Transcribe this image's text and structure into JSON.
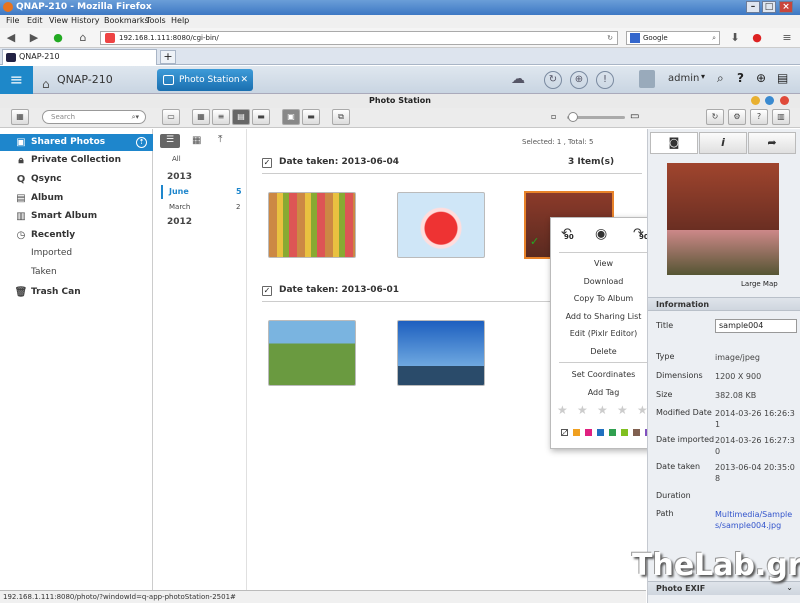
{
  "window": {
    "title": "QNAP-210 - Mozilla Firefox"
  },
  "menu": [
    "File",
    "Edit",
    "View",
    "History",
    "Bookmarks",
    "Tools",
    "Help"
  ],
  "nav": {
    "url": "192.168.1.111:8080/cgi-bin/",
    "search_placeholder": "Google"
  },
  "browser_tab": {
    "label": "QNAP-210",
    "new_tab": "+"
  },
  "header": {
    "home_label": "QNAP-210",
    "app_label": "Photo Station",
    "user": "admin"
  },
  "toolbar": {
    "title": "Photo Station",
    "search_placeholder": "Search"
  },
  "sidebar": {
    "items": [
      {
        "label": "Shared Photos",
        "icon": "photos-icon"
      },
      {
        "label": "Private Collection",
        "icon": "lock-icon"
      },
      {
        "label": "Qsync",
        "icon": "qsync-icon"
      },
      {
        "label": "Album",
        "icon": "album-icon"
      },
      {
        "label": "Smart Album",
        "icon": "smart-album-icon"
      },
      {
        "label": "Recently",
        "icon": "clock-icon"
      },
      {
        "label": "Trash Can",
        "icon": "trash-icon"
      }
    ],
    "sub": [
      "Imported",
      "Taken"
    ]
  },
  "timeline": {
    "all": "All",
    "y2013": "2013",
    "june": "June",
    "june_count": "5",
    "march": "March",
    "march_count": "2",
    "y2012": "2012"
  },
  "main": {
    "selection": "Selected: 1 , Total: 5",
    "group1": {
      "title": "Date taken: 2013-06-04",
      "count": "3 Item(s)"
    },
    "group2": {
      "title": "Date taken: 2013-06-01"
    }
  },
  "context_menu": {
    "rotate_left": "90",
    "rotate_right": "90",
    "items": [
      "View",
      "Download",
      "Copy To Album",
      "Add to Sharing List",
      "Edit (Pixlr Editor)",
      "Delete",
      "Set Coordinates",
      "Add Tag"
    ],
    "stars": 5,
    "colors": [
      "#f0a020",
      "#e02080",
      "#2070c0",
      "#30a050",
      "#80c020",
      "#806050",
      "#8050c0"
    ]
  },
  "info": {
    "large_map": "Large Map",
    "section": "Information",
    "labels": [
      "Title",
      "Type",
      "Dimensions",
      "Size",
      "Modified Date",
      "Date imported",
      "Date taken",
      "Duration",
      "Path"
    ],
    "title_value": "sample004",
    "type": "image/jpeg",
    "dimensions": "1200 X 900",
    "size": "382.08 KB",
    "modified": "2014-03-26 16:26:31",
    "imported": "2014-03-26 16:27:30",
    "taken": "2013-06-04 20:35:08",
    "duration": "",
    "path": "Multimedia/Samples/sample004.jpg",
    "exif": "Photo EXIF"
  },
  "status": "192.168.1.111:8080/photo/?windowId=q-app-photoStation-2501#",
  "watermark": "TheLab.gr"
}
